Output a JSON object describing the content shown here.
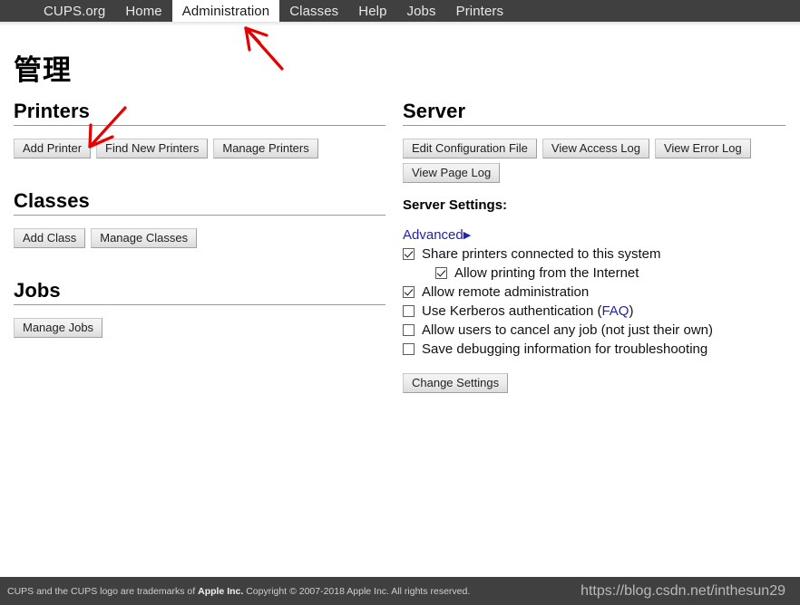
{
  "navbar": {
    "items": [
      {
        "label": "CUPS.org",
        "active": false
      },
      {
        "label": "Home",
        "active": false
      },
      {
        "label": "Administration",
        "active": true
      },
      {
        "label": "Classes",
        "active": false
      },
      {
        "label": "Help",
        "active": false
      },
      {
        "label": "Jobs",
        "active": false
      },
      {
        "label": "Printers",
        "active": false
      }
    ]
  },
  "page": {
    "title": "管理"
  },
  "left": {
    "printers": {
      "heading": "Printers",
      "buttons": [
        "Add Printer",
        "Find New Printers",
        "Manage Printers"
      ]
    },
    "classes": {
      "heading": "Classes",
      "buttons": [
        "Add Class",
        "Manage Classes"
      ]
    },
    "jobs": {
      "heading": "Jobs",
      "buttons": [
        "Manage Jobs"
      ]
    }
  },
  "right": {
    "server": {
      "heading": "Server",
      "buttons": [
        "Edit Configuration File",
        "View Access Log",
        "View Error Log",
        "View Page Log"
      ]
    },
    "settings": {
      "label": "Server Settings:",
      "advanced_label": "Advanced",
      "advanced_arrow": "▶",
      "options": [
        {
          "label": "Share printers connected to this system",
          "checked": true,
          "nested": false
        },
        {
          "label": "Allow printing from the Internet",
          "checked": true,
          "nested": true
        },
        {
          "label": "Allow remote administration",
          "checked": true,
          "nested": false
        },
        {
          "label": "Use Kerberos authentication (",
          "checked": false,
          "nested": false,
          "link": "FAQ",
          "suffix": ")"
        },
        {
          "label": "Allow users to cancel any job (not just their own)",
          "checked": false,
          "nested": false
        },
        {
          "label": "Save debugging information for troubleshooting",
          "checked": false,
          "nested": false
        }
      ],
      "change_button": "Change Settings"
    }
  },
  "footer": {
    "text_before": "CUPS and the CUPS logo are trademarks of ",
    "text_bold": "Apple Inc.",
    "text_after": " Copyright © 2007-2018 Apple Inc. All rights reserved.",
    "watermark": "https://blog.csdn.net/inthesun29"
  },
  "colors": {
    "navbar_bg": "#404040",
    "accent_link": "#2222aa",
    "annotation": "#e60000"
  }
}
